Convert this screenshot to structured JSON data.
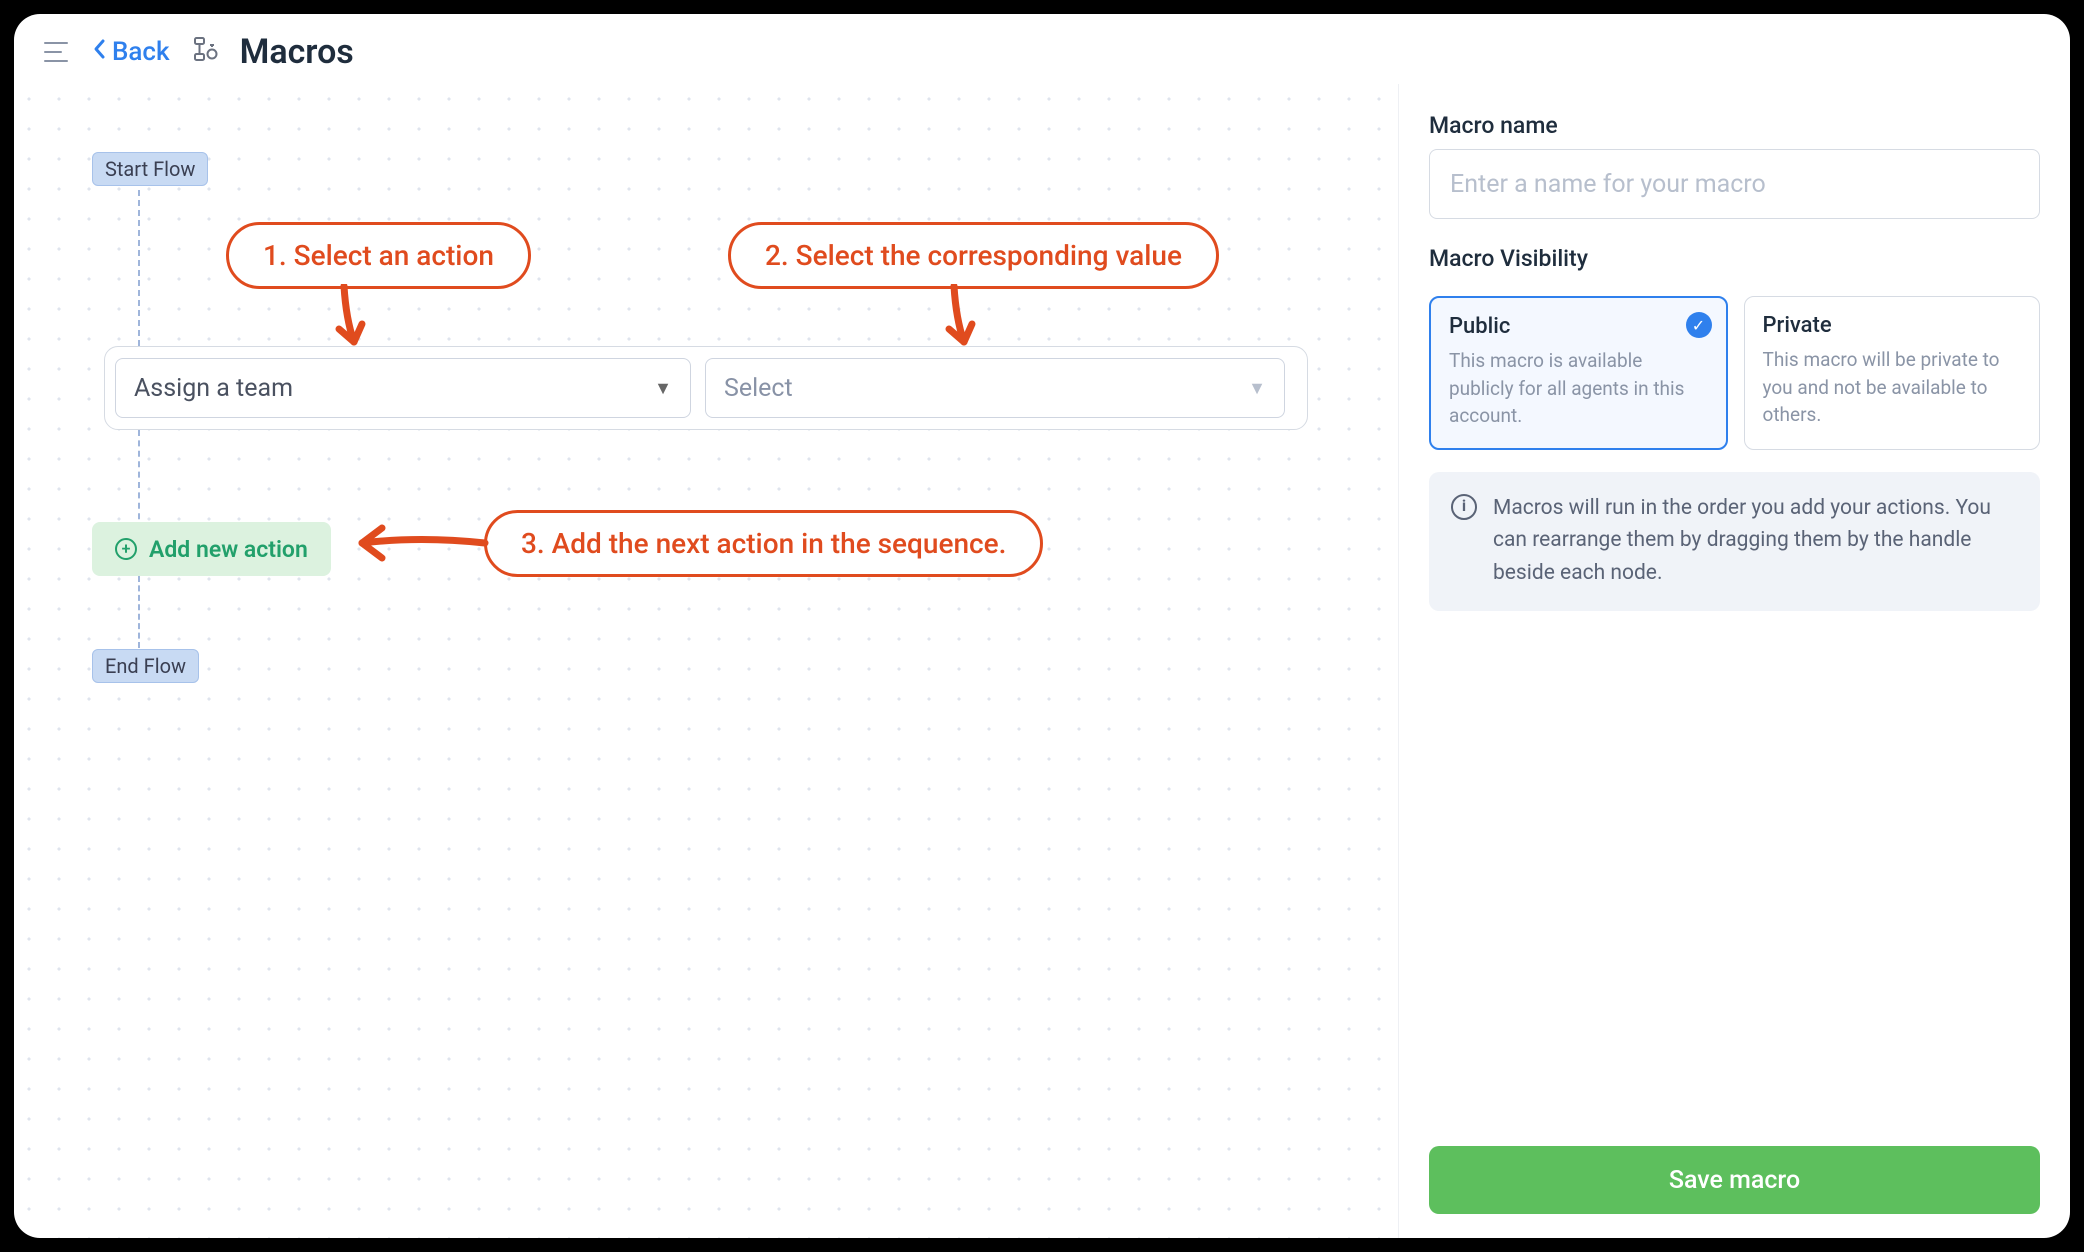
{
  "header": {
    "back_label": "Back",
    "page_title": "Macros"
  },
  "flow": {
    "start_label": "Start Flow",
    "end_label": "End Flow",
    "action_select_value": "Assign a team",
    "value_select_placeholder": "Select",
    "add_action_label": "Add new action"
  },
  "annotations": {
    "step1": "1. Select an action",
    "step2": "2. Select the corresponding value",
    "step3": "3. Add the next action in the sequence."
  },
  "sidebar": {
    "name_label": "Macro name",
    "name_placeholder": "Enter a name for your macro",
    "visibility_label": "Macro Visibility",
    "public": {
      "title": "Public",
      "desc": "This macro is available publicly for all agents in this account."
    },
    "private": {
      "title": "Private",
      "desc": "This macro will be private to you and not be available to others."
    },
    "info_text": "Macros will run in the order you add your actions. You can rearrange them by dragging them by the handle beside each node.",
    "save_label": "Save macro"
  }
}
